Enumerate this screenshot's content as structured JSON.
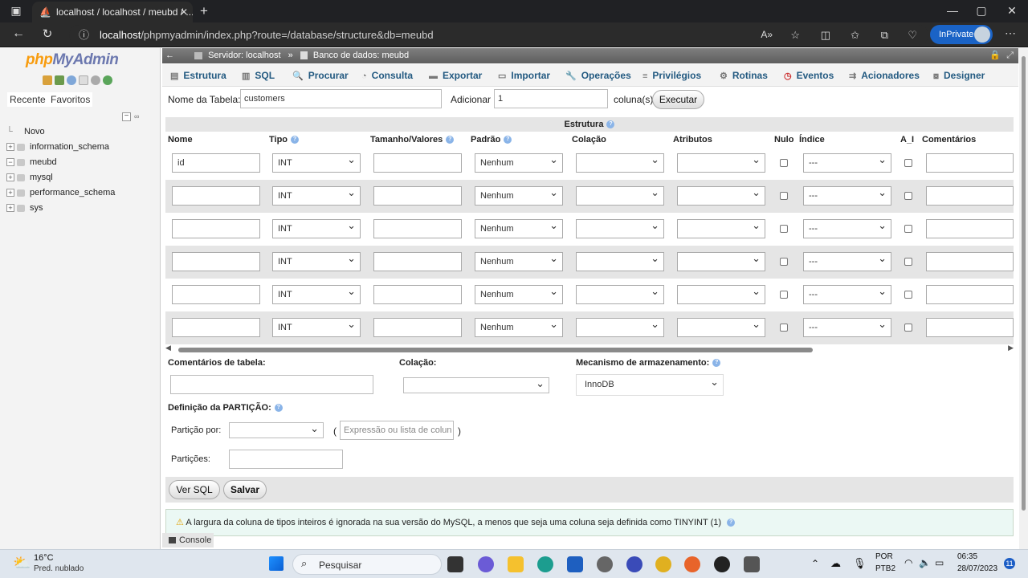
{
  "browser": {
    "tab_title": "localhost / localhost / meubd / ...",
    "url_host": "localhost",
    "url_path": "/phpmyadmin/index.php?route=/database/structure&db=meubd",
    "inprivate_label": "InPrivate"
  },
  "sidebar": {
    "logo_php": "php",
    "logo_myadmin": "MyAdmin",
    "recent_label": "Recente",
    "favorites_label": "Favoritos",
    "tree": [
      {
        "label": "Novo"
      },
      {
        "label": "information_schema"
      },
      {
        "label": "meubd"
      },
      {
        "label": "mysql"
      },
      {
        "label": "performance_schema"
      },
      {
        "label": "sys"
      }
    ]
  },
  "breadcrumb": {
    "server": "Servidor: localhost",
    "sep": "»",
    "database": "Banco de dados: meubd"
  },
  "menu": [
    {
      "label": "Estrutura",
      "icon": "structure-icon"
    },
    {
      "label": "SQL",
      "icon": "sql-icon"
    },
    {
      "label": "Procurar",
      "icon": "search-icon"
    },
    {
      "label": "Consulta",
      "icon": "query-icon"
    },
    {
      "label": "Exportar",
      "icon": "export-icon"
    },
    {
      "label": "Importar",
      "icon": "import-icon"
    },
    {
      "label": "Operações",
      "icon": "wrench-icon"
    },
    {
      "label": "Privilégios",
      "icon": "privileges-icon"
    },
    {
      "label": "Rotinas",
      "icon": "routines-icon"
    },
    {
      "label": "Eventos",
      "icon": "clock-icon"
    },
    {
      "label": "Acionadores",
      "icon": "triggers-icon"
    },
    {
      "label": "Designer",
      "icon": "designer-icon"
    }
  ],
  "form": {
    "table_name_label": "Nome da Tabela:",
    "table_name_value": "customers",
    "add_label": "Adicionar",
    "add_value": "1",
    "columns_label": "coluna(s)",
    "execute_label": "Executar",
    "structure_label": "Estrutura"
  },
  "columns": {
    "name": "Nome",
    "type": "Tipo",
    "length": "Tamanho/Valores",
    "default": "Padrão",
    "collation": "Colação",
    "attributes": "Atributos",
    "null": "Nulo",
    "index": "Índice",
    "ai": "A_I",
    "comments": "Comentários"
  },
  "rows": [
    {
      "name": "id",
      "type": "INT",
      "default": "Nenhum",
      "index": "---"
    },
    {
      "name": "",
      "type": "INT",
      "default": "Nenhum",
      "index": "---"
    },
    {
      "name": "",
      "type": "INT",
      "default": "Nenhum",
      "index": "---"
    },
    {
      "name": "",
      "type": "INT",
      "default": "Nenhum",
      "index": "---"
    },
    {
      "name": "",
      "type": "INT",
      "default": "Nenhum",
      "index": "---"
    },
    {
      "name": "",
      "type": "INT",
      "default": "Nenhum",
      "index": "---"
    }
  ],
  "table_options": {
    "comments_label": "Comentários de tabela:",
    "collation_label": "Colação:",
    "engine_label": "Mecanismo de armazenamento:",
    "engine_value": "InnoDB"
  },
  "partition": {
    "title": "Definição da PARTIÇÃO:",
    "by_label": "Partição por:",
    "expr_open": "(",
    "expr_placeholder": "Expressão ou lista de colun",
    "expr_close": ")",
    "partitions_label": "Partições:"
  },
  "actions": {
    "preview_sql": "Ver SQL",
    "save": "Salvar"
  },
  "notice": "A largura da coluna de tipos inteiros é ignorada na sua versão do MySQL, a menos que seja uma coluna seja definida como TINYINT (1)",
  "console_label": "Console",
  "taskbar": {
    "weather_temp": "16°C",
    "weather_desc": "Pred. nublado",
    "search_placeholder": "Pesquisar",
    "lang_top": "POR",
    "lang_bottom": "PTB2",
    "time": "06:35",
    "date": "28/07/2023",
    "notifications": "11"
  }
}
